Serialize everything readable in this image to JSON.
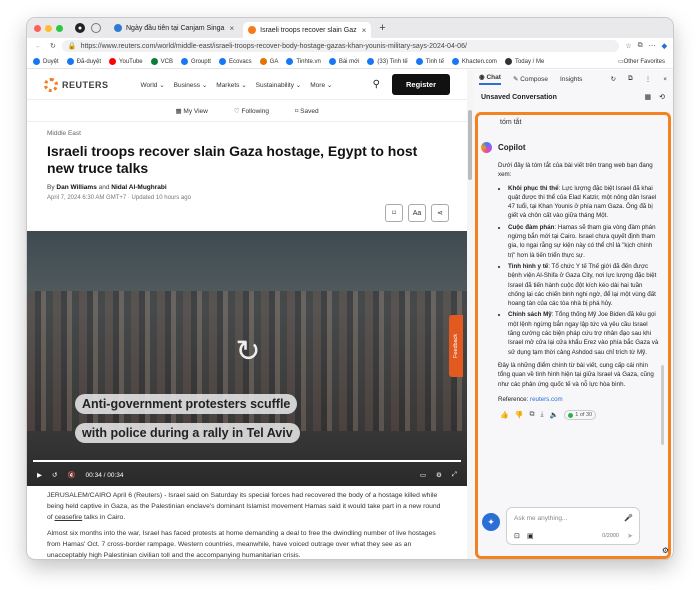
{
  "tabs": [
    {
      "label": "Ngày đầu tiên tại Canjam Singa",
      "color": "#2f7bd3"
    },
    {
      "label": "Israeli troops recover slain Gaz",
      "color": "#f77b1c"
    }
  ],
  "url": "https://www.reuters.com/world/middle-east/israeli-troops-recover-body-hostage-gazas-khan-younis-military-says-2024-04-06/",
  "bookmarks": [
    {
      "label": "Duyệt",
      "color": "#1877f2"
    },
    {
      "label": "Đã-duyệt",
      "color": "#1877f2"
    },
    {
      "label": "YouTube",
      "color": "#ff0000"
    },
    {
      "label": "VCB",
      "color": "#0a7d3a"
    },
    {
      "label": "Grouptt",
      "color": "#1877f2"
    },
    {
      "label": "Ecovacs",
      "color": "#1877f2"
    },
    {
      "label": "GA",
      "color": "#e37400"
    },
    {
      "label": "Tinhte.vn",
      "color": "#1877f2"
    },
    {
      "label": "Bài mới",
      "color": "#1877f2"
    },
    {
      "label": "(33) Tinh tế",
      "color": "#1877f2"
    },
    {
      "label": "Tinh tế",
      "color": "#1877f2"
    },
    {
      "label": "Khacten.com",
      "color": "#1877f2"
    },
    {
      "label": "Today / Me",
      "color": "#333"
    }
  ],
  "bookmarks_other": "Other Favorites",
  "site": {
    "logo": "REUTERS",
    "nav": [
      "World",
      "Business",
      "Markets",
      "Sustainability",
      "More"
    ],
    "register": "Register",
    "subnav": [
      "My View",
      "Following",
      "Saved"
    ]
  },
  "article": {
    "kicker": "Middle East",
    "title": "Israeli troops recover slain Gaza hostage, Egypt to host new truce talks",
    "by_prefix": "By",
    "author1": "Dan Williams",
    "and": "and",
    "author2": "Nidal Al-Mughrabi",
    "date": "April 7, 2024 6:30 AM GMT+7 · Updated 10 hours ago",
    "tool_aa": "Aa",
    "caption1": "Anti-government protesters scuffle",
    "caption2": "with police during a rally in Tel Aviv",
    "time_cur": "00:34",
    "time_total": "/ 00:34",
    "p1_text": "JERUSALEM/CAIRO April 6 (Reuters) - Israel said on Saturday its special forces had recovered the body of a hostage killed while being held captive in Gaza, as the Palestinian enclave's dominant Islamist movement Hamas said it would take part in a new round of ",
    "p1_link": "ceasefire",
    "p1_end": " talks in Cairo.",
    "p2": "Almost six months into the war, Israel has faced protests at home demanding a deal to free the dwindling number of live hostages from Hamas' Oct. 7 cross-border rampage. Western countries, meanwhile, have voiced outrage over what they see as an unacceptably high Palestinian civilian toll and the accompanying humanitarian crisis."
  },
  "feedback": "Feedback",
  "sidebar": {
    "tabs": [
      "Chat",
      "Compose",
      "Insights"
    ],
    "title": "Unsaved Conversation",
    "user_msg": "tóm tắt",
    "bot_name": "Copilot",
    "intro": "Dưới đây là tóm tắt của bài viết trên trang web bạn đang xem:",
    "points": [
      {
        "h": "Khôi phục thi thể",
        "t": ": Lực lượng đặc biệt Israel đã khai quật được thi thể của Elad Katzir, một nông dân Israel 47 tuổi, tại Khan Younis ở phía nam Gaza. Ông đã bị giết và chôn cất vào giữa tháng Một."
      },
      {
        "h": "Cuộc đàm phán",
        "t": ": Hamas sẽ tham gia vòng đàm phán ngừng bắn mới tại Cairo. Israel chưa quyết định tham gia, lo ngại rằng sự kiện này có thể chỉ là \"kịch chính trị\" hơn là tiến triển thực sự."
      },
      {
        "h": "Tình hình y tế",
        "t": ": Tổ chức Y tế Thế giới đã đến được bệnh viện Al-Shifa ở Gaza City, nơi lực lượng đặc biệt Israel đã tiến hành cuộc đột kích kéo dài hai tuần chống lại các chiến binh nghi ngờ, để lại một vùng đất hoang tàn của các tòa nhà bị phá hủy."
      },
      {
        "h": "Chính sách Mỹ",
        "t": ": Tổng thống Mỹ Joe Biden đã kêu gọi một lệnh ngừng bắn ngay lập tức và yêu cầu Israel tăng cường các biện pháp cứu trợ nhân đạo sau khi Israel mở cửa lại cửa khẩu Erez vào phía bắc Gaza và sử dụng tạm thời cảng Ashdod sau chỉ trích từ Mỹ."
      }
    ],
    "outro": "Đây là những điểm chính từ bài viết, cung cấp cái nhìn tổng quan về tình hình hiện tại giữa Israel và Gaza, cũng như các phản ứng quốc tế và nỗ lực hòa bình.",
    "ref_label": "Reference:",
    "ref_link": "reuters.com",
    "count": "1 of 30",
    "placeholder": "Ask me anything...",
    "char_count": "0/2000"
  }
}
